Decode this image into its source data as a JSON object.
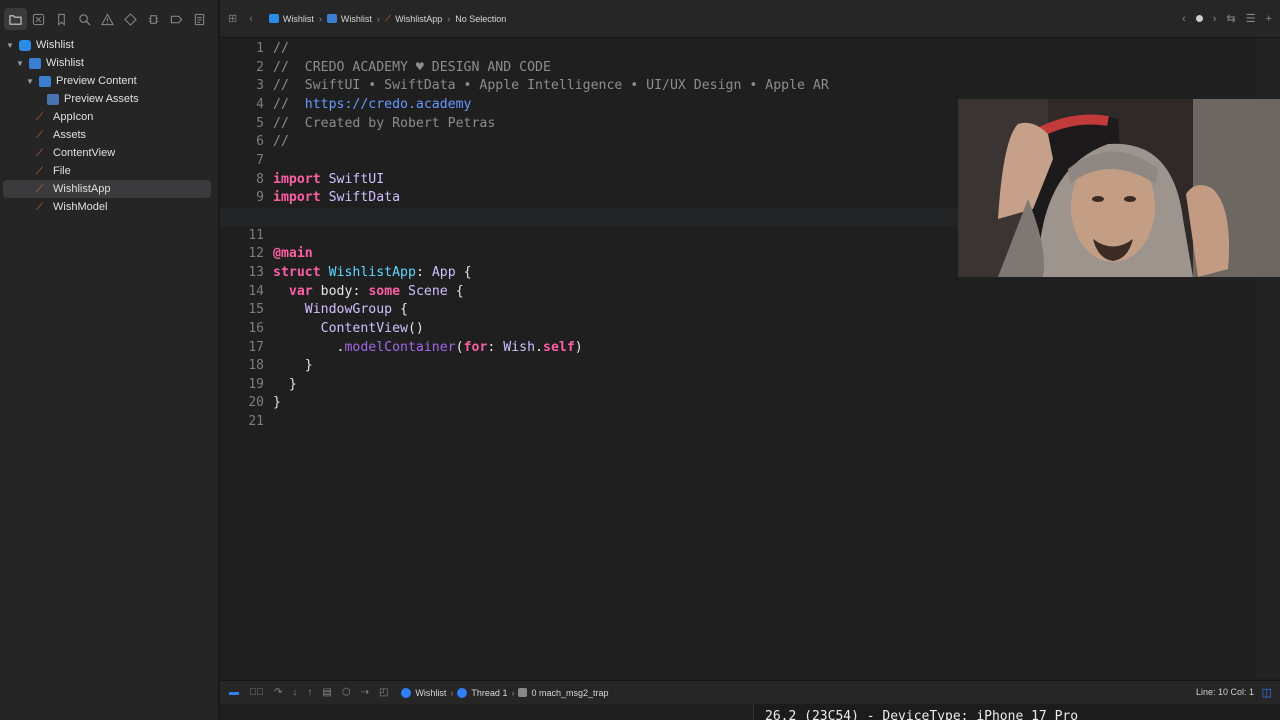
{
  "navigator": {
    "toolbar_icons": [
      "folder-icon",
      "source-control-icon",
      "bookmark-icon",
      "find-icon",
      "issue-icon",
      "test-icon",
      "debug-icon",
      "breakpoint-icon",
      "report-icon"
    ],
    "tree": [
      {
        "label": "Wishlist",
        "icon": "project",
        "indent": 0,
        "disclosure": "▾"
      },
      {
        "label": "Wishlist",
        "icon": "folder",
        "indent": 1,
        "disclosure": "▾"
      },
      {
        "label": "Preview Content",
        "icon": "folder",
        "indent": 2,
        "disclosure": "▾"
      },
      {
        "label": "Preview Assets",
        "icon": "asset",
        "indent": 3,
        "disclosure": ""
      },
      {
        "label": "AppIcon",
        "icon": "swift",
        "indent": 2,
        "disclosure": ""
      },
      {
        "label": "Assets",
        "icon": "swift",
        "indent": 2,
        "disclosure": ""
      },
      {
        "label": "ContentView",
        "icon": "swift",
        "indent": 2,
        "disclosure": ""
      },
      {
        "label": "File",
        "icon": "swift",
        "indent": 2,
        "disclosure": ""
      },
      {
        "label": "WishlistApp",
        "icon": "swift",
        "indent": 2,
        "disclosure": "",
        "selected": true
      },
      {
        "label": "WishModel",
        "icon": "swift",
        "indent": 2,
        "disclosure": ""
      }
    ]
  },
  "jumpbar": {
    "items": [
      "Wishlist",
      "Wishlist",
      "WishlistApp",
      "No Selection"
    ]
  },
  "editor": {
    "current_line": 10,
    "lines": [
      "//",
      "//  CREDO ACADEMY ♥ DESIGN AND CODE",
      "//  SwiftUI • SwiftData • Apple Intelligence • UI/UX Design • Apple AR",
      "//  https://credo.academy",
      "//  Created by Robert Petras",
      "//",
      "",
      "import SwiftUI",
      "import SwiftData",
      "",
      "",
      "@main",
      "struct WishlistApp: App {",
      "  var body: some Scene {",
      "    WindowGroup {",
      "      ContentView()",
      "        .modelContainer(for: Wish.self)",
      "    }",
      "  }",
      "}",
      ""
    ]
  },
  "debugbar": {
    "scheme": "Wishlist",
    "thread": "Thread 1",
    "frame": "0 mach_msg2_trap",
    "position": "Line: 10  Col: 1"
  },
  "console": {
    "text": "26.2 (23C54) - DeviceType: iPhone 17 Pro"
  },
  "colors": {
    "keyword": "#fc5fa3",
    "comment": "#8a8d91",
    "link": "#6699ff",
    "type": "#d0bfff",
    "attribute": "#fd8f3f",
    "accent": "#2f7ff5"
  }
}
